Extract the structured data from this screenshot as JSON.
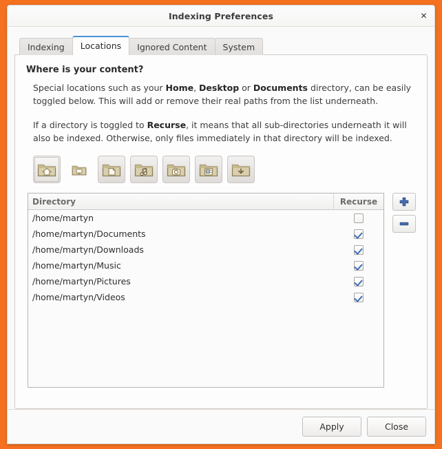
{
  "window": {
    "title": "Indexing Preferences",
    "close_label": "✕",
    "close_icon": "close-icon"
  },
  "tabs": [
    {
      "label": "Indexing",
      "active": false
    },
    {
      "label": "Locations",
      "active": true
    },
    {
      "label": "Ignored Content",
      "active": false
    },
    {
      "label": "System",
      "active": false
    }
  ],
  "panel": {
    "heading": "Where is your content?",
    "paragraph1_pre": "Special locations such as your ",
    "paragraph1_b1": "Home",
    "paragraph1_mid1": ", ",
    "paragraph1_b2": "Desktop",
    "paragraph1_mid2": " or ",
    "paragraph1_b3": "Documents",
    "paragraph1_post": " directory, can be easily toggled below. This will add or remove their real paths from the list underneath.",
    "paragraph2_pre": "If a directory is toggled to ",
    "paragraph2_b1": "Recurse",
    "paragraph2_post": ", it means that all sub-directories underneath it will also be indexed. Otherwise, only files immediately in that directory will be indexed."
  },
  "location_buttons": [
    {
      "name": "home-folder-button",
      "icon": "folder-home-icon",
      "state": "active-focused"
    },
    {
      "name": "desktop-folder-button",
      "icon": "folder-desktop-icon",
      "state": "flat"
    },
    {
      "name": "documents-folder-button",
      "icon": "folder-documents-icon",
      "state": "raised"
    },
    {
      "name": "music-folder-button",
      "icon": "folder-music-icon",
      "state": "raised"
    },
    {
      "name": "pictures-folder-button",
      "icon": "folder-pictures-icon",
      "state": "raised"
    },
    {
      "name": "videos-folder-button",
      "icon": "folder-videos-icon",
      "state": "raised"
    },
    {
      "name": "downloads-folder-button",
      "icon": "folder-downloads-icon",
      "state": "raised"
    }
  ],
  "list": {
    "columns": {
      "directory": "Directory",
      "recurse": "Recurse"
    },
    "rows": [
      {
        "path": "/home/martyn",
        "recurse": false
      },
      {
        "path": "/home/martyn/Documents",
        "recurse": true
      },
      {
        "path": "/home/martyn/Downloads",
        "recurse": true
      },
      {
        "path": "/home/martyn/Music",
        "recurse": true
      },
      {
        "path": "/home/martyn/Pictures",
        "recurse": true
      },
      {
        "path": "/home/martyn/Videos",
        "recurse": true
      }
    ]
  },
  "side_buttons": {
    "add_icon": "plus-icon",
    "remove_icon": "minus-icon"
  },
  "status": {
    "text": ""
  },
  "actions": {
    "apply_label": "Apply",
    "close_label": "Close"
  },
  "colors": {
    "desktop_orange": "#f4711f",
    "active_tab_accent": "#4a90d9",
    "checkbox_check": "#3b6fb5",
    "dialog_bg": "#fafafa"
  }
}
